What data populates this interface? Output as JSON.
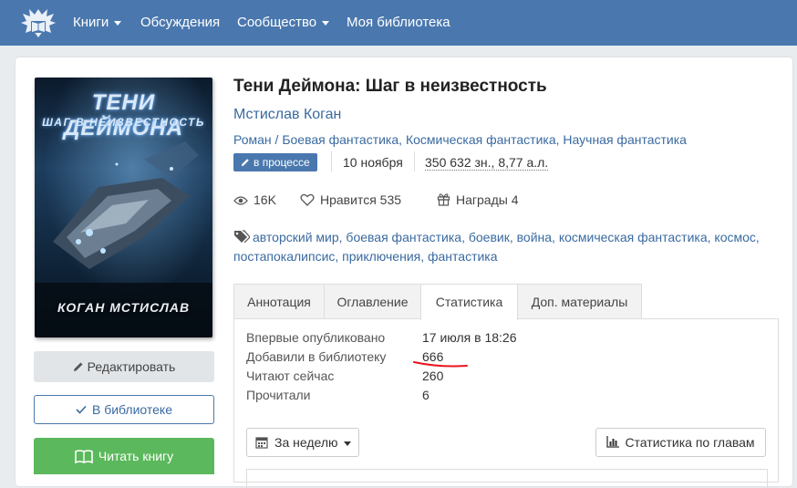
{
  "nav": {
    "items": [
      {
        "label": "Книги",
        "has_caret": true
      },
      {
        "label": "Обсуждения",
        "has_caret": false
      },
      {
        "label": "Сообщество",
        "has_caret": true
      },
      {
        "label": "Моя библиотека",
        "has_caret": false
      }
    ]
  },
  "book": {
    "title": "Тени Деймона: Шаг в неизвестность",
    "author": "Мстислав Коган",
    "genres": [
      "Роман",
      "Боевая фантастика",
      "Космическая фантастика",
      "Научная фантастика"
    ],
    "genres_sep_first": " / ",
    "status": "в процессе",
    "date": "10 ноября",
    "size": "350 632 зн., 8,77 а.л."
  },
  "cover": {
    "title": "ТЕНИ ДЕЙМОНА",
    "subtitle": "ШАГ В НЕИЗВЕСТНОСТЬ",
    "author": "КОГАН МСТИСЛАВ"
  },
  "stats": {
    "views": "16K",
    "likes_label": "Нравится",
    "likes": "535",
    "awards_label": "Награды",
    "awards": "4"
  },
  "tags": [
    "авторский мир",
    "боевая фантастика",
    "боевик",
    "война",
    "космическая фантастика",
    "космос",
    "постапокалипсис",
    "приключения",
    "фантастика"
  ],
  "actions": {
    "edit": "Редактировать",
    "library": "В библиотеке",
    "read": "Читать книгу"
  },
  "tabs": [
    {
      "label": "Аннотация",
      "active": false
    },
    {
      "label": "Оглавление",
      "active": false
    },
    {
      "label": "Статистика",
      "active": true
    },
    {
      "label": "Доп. материалы",
      "active": false
    }
  ],
  "statistics": [
    {
      "label": "Впервые опубликовано",
      "value": "17 июля в 18:26"
    },
    {
      "label": "Добавили в библиотеку",
      "value": "666"
    },
    {
      "label": "Читают сейчас",
      "value": "260"
    },
    {
      "label": "Прочитали",
      "value": "6"
    }
  ],
  "period_select": {
    "value": "За неделю"
  },
  "chapters_button": "Статистика по главам",
  "colors": {
    "navbar": "#4a78ae",
    "link": "#3a6aa0",
    "read_button": "#5cb85c",
    "annotation_underline": "#e8141c"
  }
}
